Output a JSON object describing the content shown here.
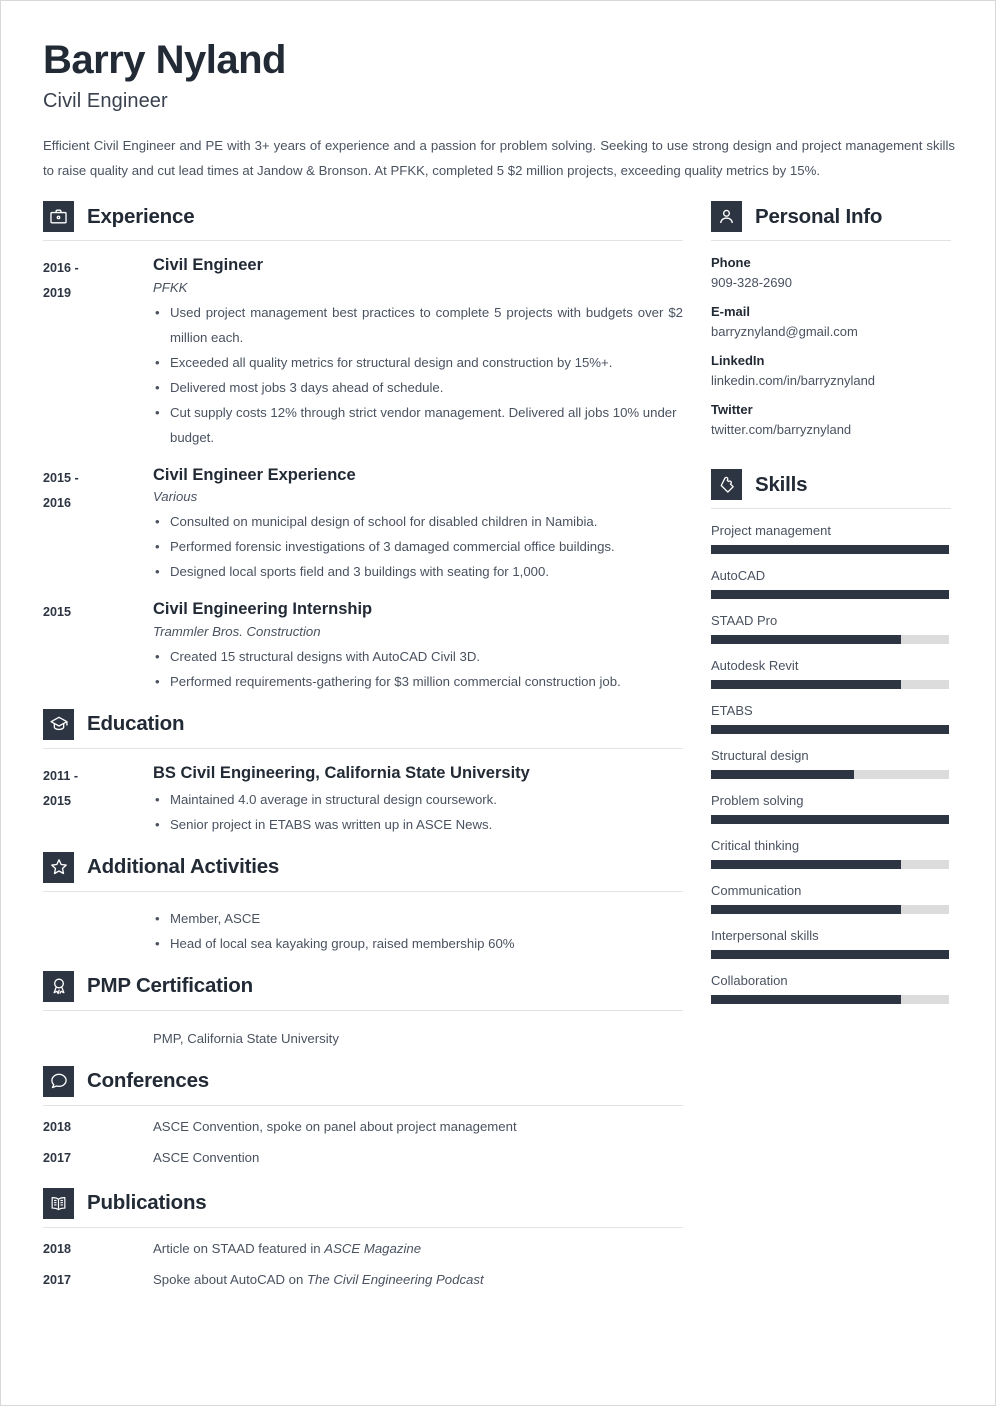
{
  "header": {
    "name": "Barry Nyland",
    "job_title": "Civil Engineer",
    "summary": "Efficient Civil Engineer and PE with 3+ years of experience and a passion for problem solving. Seeking to use strong design and project management skills to raise quality and cut lead times at Jandow & Bronson. At PFKK, completed 5 $2 million projects, exceeding quality metrics by 15%."
  },
  "colors": {
    "accent_dark": "#2d3543",
    "text_heading": "#222a35",
    "text_body": "#4a5260",
    "rule": "#e2e2e2",
    "track": "#dcdcdc",
    "page_border": "#d8d8d8"
  },
  "sections": {
    "experience": {
      "title": "Experience",
      "icon": "briefcase-icon",
      "entries": [
        {
          "dates_line1": "2016 -",
          "dates_line2": "2019",
          "role": "Civil Engineer",
          "org": "PFKK",
          "bullets": [
            "Used project management best practices to complete 5 projects with budgets over $2 million each.",
            "Exceeded all quality metrics for structural design and construction by 15%+.",
            "Delivered most jobs 3 days ahead of schedule.",
            "Cut supply costs 12% through strict vendor management. Delivered all jobs 10% under budget."
          ]
        },
        {
          "dates_line1": "2015 -",
          "dates_line2": "2016",
          "role": "Civil Engineer Experience",
          "org": "Various",
          "bullets": [
            "Consulted on municipal design of school for disabled children in Namibia.",
            "Performed forensic investigations of 3 damaged commercial office buildings.",
            "Designed local sports field and 3 buildings with seating for 1,000."
          ]
        },
        {
          "dates_line1": "2015",
          "dates_line2": "",
          "role": "Civil Engineering Internship",
          "org": "Trammler Bros. Construction",
          "bullets": [
            "Created 15 structural designs with AutoCAD Civil 3D.",
            "Performed requirements-gathering for $3 million commercial construction job."
          ]
        }
      ]
    },
    "education": {
      "title": "Education",
      "icon": "graduation-cap-icon",
      "entries": [
        {
          "dates_line1": "2011 -",
          "dates_line2": "2015",
          "degree": "BS Civil Engineering, California State University",
          "bullets": [
            "Maintained 4.0 average in structural design coursework.",
            "Senior project in ETABS was written up in ASCE News."
          ]
        }
      ]
    },
    "additional_activities": {
      "title": "Additional Activities",
      "icon": "star-icon",
      "bullets": [
        "Member, ASCE",
        "Head of local sea kayaking group, raised membership 60%"
      ]
    },
    "pmp_certification": {
      "title": "PMP Certification",
      "icon": "award-ribbon-icon",
      "text": "PMP, California State University"
    },
    "conferences": {
      "title": "Conferences",
      "icon": "speech-bubble-icon",
      "items": [
        {
          "year": "2018",
          "text_plain": "ASCE Convention, spoke on panel about project management",
          "text_italic": ""
        },
        {
          "year": "2017",
          "text_plain": "ASCE Convention",
          "text_italic": ""
        }
      ]
    },
    "publications": {
      "title": "Publications",
      "icon": "open-book-icon",
      "items": [
        {
          "year": "2018",
          "text_plain": "Article on STAAD featured in ",
          "text_italic": "ASCE Magazine"
        },
        {
          "year": "2017",
          "text_plain": "Spoke about AutoCAD on ",
          "text_italic": "The Civil Engineering Podcast"
        }
      ]
    },
    "personal_info": {
      "title": "Personal Info",
      "icon": "person-icon",
      "fields": [
        {
          "label": "Phone",
          "value": "909-328-2690"
        },
        {
          "label": "E-mail",
          "value": "barryznyland@gmail.com"
        },
        {
          "label": "LinkedIn",
          "value": "linkedin.com/in/barryznyland"
        },
        {
          "label": "Twitter",
          "value": "twitter.com/barryznyland"
        }
      ]
    },
    "skills": {
      "title": "Skills",
      "icon": "puzzle-piece-icon",
      "items": [
        {
          "name": "Project management",
          "level": 100
        },
        {
          "name": "AutoCAD",
          "level": 100
        },
        {
          "name": "STAAD Pro",
          "level": 80
        },
        {
          "name": "Autodesk Revit",
          "level": 80
        },
        {
          "name": "ETABS",
          "level": 100
        },
        {
          "name": "Structural design",
          "level": 60
        },
        {
          "name": "Problem solving",
          "level": 100
        },
        {
          "name": "Critical thinking",
          "level": 80
        },
        {
          "name": "Communication",
          "level": 80
        },
        {
          "name": "Interpersonal skills",
          "level": 100
        },
        {
          "name": "Collaboration",
          "level": 80
        }
      ]
    }
  }
}
